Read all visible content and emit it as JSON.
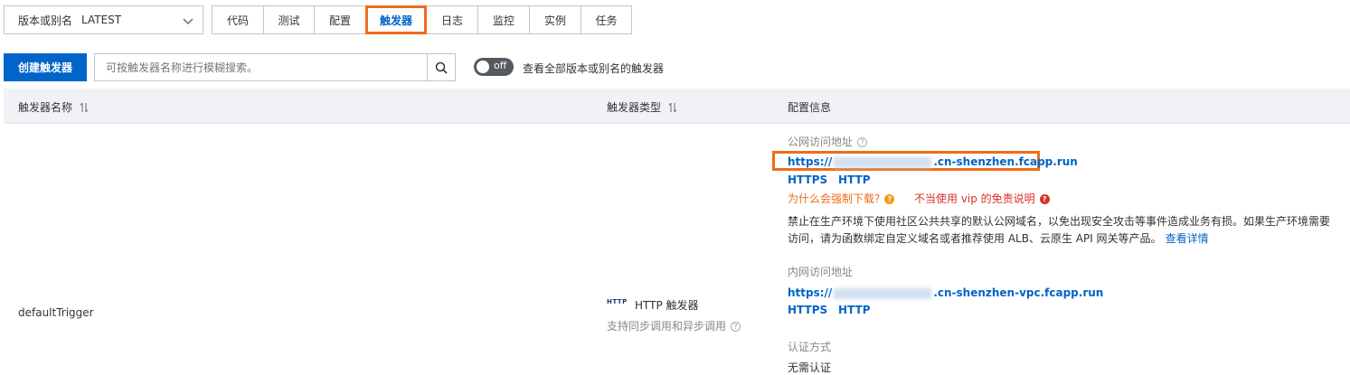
{
  "version_select": {
    "label": "版本或别名",
    "value": "LATEST"
  },
  "tabs": [
    {
      "label": "代码"
    },
    {
      "label": "测试"
    },
    {
      "label": "配置"
    },
    {
      "label": "触发器"
    },
    {
      "label": "日志"
    },
    {
      "label": "监控"
    },
    {
      "label": "实例"
    },
    {
      "label": "任务"
    }
  ],
  "active_tab": "触发器",
  "toolbar": {
    "create_label": "创建触发器",
    "search_placeholder": "可按触发器名称进行模糊搜索。",
    "toggle_text": "off",
    "toggle_label": "查看全部版本或别名的触发器"
  },
  "table": {
    "columns": [
      "触发器名称",
      "触发器类型",
      "配置信息"
    ],
    "rows": [
      {
        "name": "defaultTrigger",
        "type_tag": "HTTP",
        "type_label": "HTTP 触发器",
        "type_desc": "支持同步调用和异步调用",
        "public_title": "公网访问地址",
        "public_url_prefix": "https://",
        "public_url_suffix": ".cn-shenzhen.fcapp.run",
        "public_protocols": [
          "HTTPS",
          "HTTP"
        ],
        "warn_download": "为什么会强制下载?",
        "warn_vip": "不当使用 vip 的免责说明",
        "notice_line1": "禁止在生产环境下使用社区公共共享的默认公网域名，以免出现安全攻击等事件造成业务有损。如果生产环境需要",
        "notice_line2": "访问，请为函数绑定自定义域名或者推荐使用 ALB、云原生 API 网关等产品。",
        "notice_link": "查看详情",
        "private_title": "内网访问地址",
        "private_url_prefix": "https://",
        "private_url_suffix": ".cn-shenzhen-vpc.fcapp.run",
        "private_protocols": [
          "HTTPS",
          "HTTP"
        ],
        "auth_title": "认证方式",
        "auth_value": "无需认证"
      }
    ]
  },
  "colors": {
    "primary": "#0064c8",
    "highlight": "#ed6d1a",
    "danger": "#d93026",
    "header_bg": "#f0f2f5"
  },
  "icons": [
    "chevron-down-icon",
    "search-icon",
    "sort-icon",
    "help-icon",
    "warning-icon",
    "http-icon"
  ]
}
